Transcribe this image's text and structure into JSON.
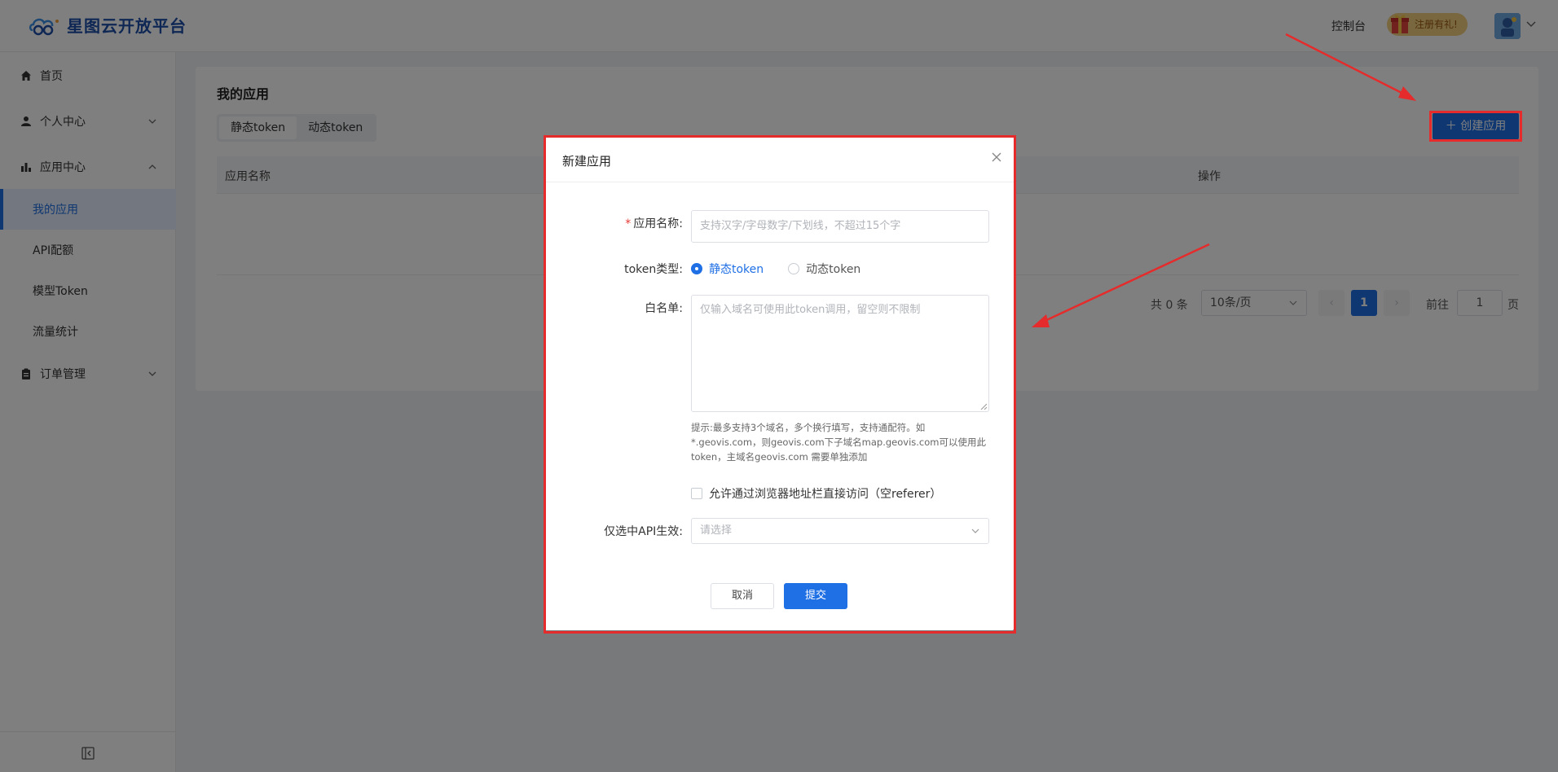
{
  "brand": {
    "name": "星图云开放平台",
    "accent": "#1f6fe5"
  },
  "header": {
    "console_label": "控制台",
    "promo_label": "注册有礼!"
  },
  "sidebar": {
    "items": [
      {
        "label": "首页",
        "icon": "home-icon"
      },
      {
        "label": "个人中心",
        "icon": "user-icon"
      },
      {
        "label": "应用中心",
        "icon": "bar-chart-icon"
      },
      {
        "label": "订单管理",
        "icon": "clipboard-icon"
      }
    ],
    "sub_items": [
      {
        "label": "我的应用",
        "active": true
      },
      {
        "label": "API配额"
      },
      {
        "label": "模型Token"
      },
      {
        "label": "流量统计"
      }
    ]
  },
  "main": {
    "title": "我的应用",
    "tabs": [
      "静态token",
      "动态token"
    ],
    "create_button": "创建应用",
    "table": {
      "columns": [
        "应用名称",
        "操作"
      ]
    },
    "pagination": {
      "total": "共 0 条",
      "page_size": "10条/页",
      "prev": "‹",
      "current_page": "1",
      "next": "›",
      "goto_label": "前往",
      "goto_value": "1",
      "page_unit": "页"
    }
  },
  "modal": {
    "title": "新建应用",
    "fields": {
      "app_name": {
        "required_mark": "*",
        "label": "应用名称:",
        "placeholder": "支持汉字/字母数字/下划线，不超过15个字"
      },
      "token_type": {
        "label": "token类型:",
        "options": [
          "静态token",
          "动态token"
        ],
        "selected": "静态token"
      },
      "whitelist": {
        "label": "白名单:",
        "placeholder": "仅输入域名可使用此token调用，留空则不限制",
        "hint": "提示:最多支持3个域名，多个换行填写，支持通配符。如*.geovis.com，则geovis.com下子域名map.geovis.com可以使用此token，主域名geovis.com 需要单独添加"
      },
      "allow_empty_referer": {
        "label": "允许通过浏览器地址栏直接访问（空referer）",
        "checked": false
      },
      "api_scope": {
        "label": "仅选中API生效:",
        "placeholder": "请选择"
      }
    },
    "cancel_button": "取消",
    "submit_button": "提交"
  },
  "colors": {
    "annotation_red": "#e52b2b",
    "primary_blue": "#1f6fe5"
  }
}
